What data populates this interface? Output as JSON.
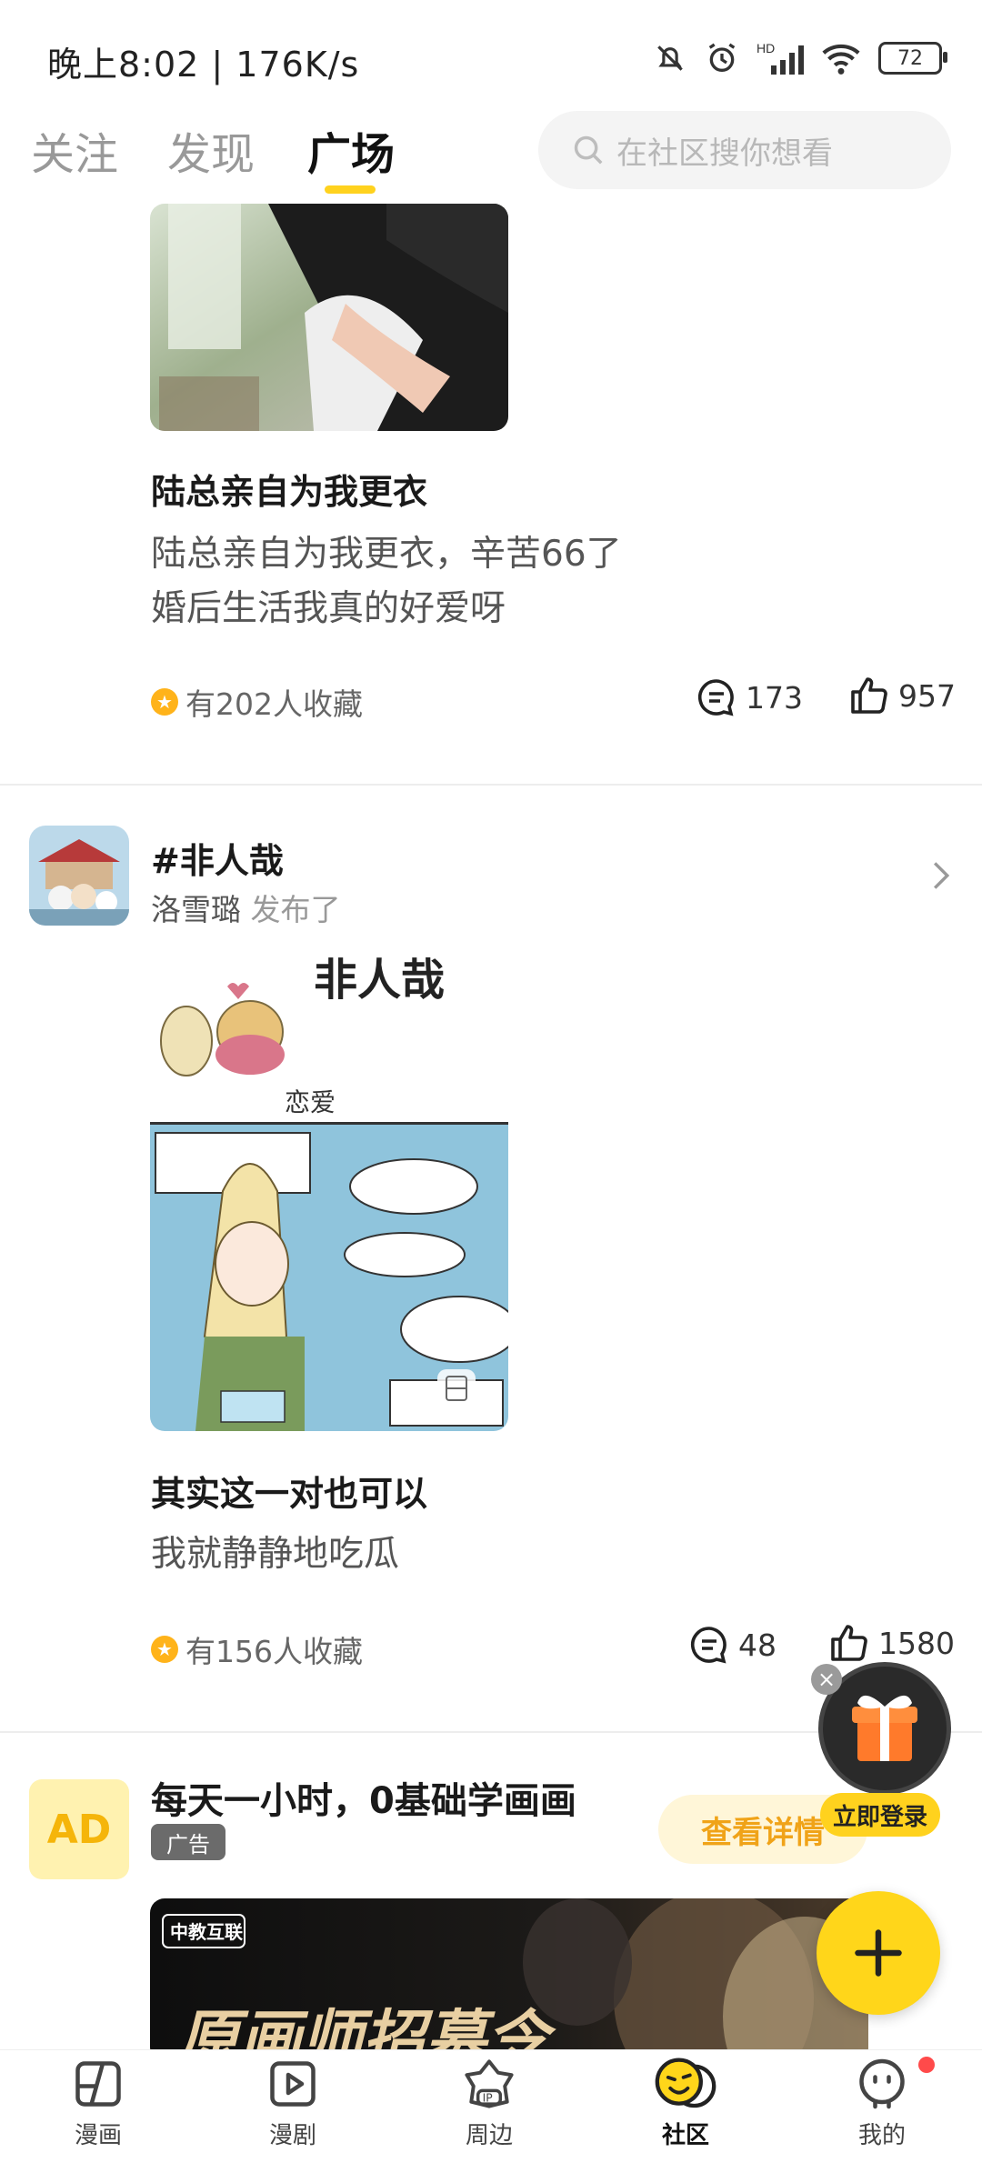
{
  "status_bar": {
    "time": "晚上8:02 | 176K/s",
    "battery": "72"
  },
  "top_tabs": [
    {
      "label": "关注"
    },
    {
      "label": "发现"
    },
    {
      "label": "广场"
    }
  ],
  "search": {
    "placeholder": "在社区搜你想看"
  },
  "post1": {
    "title": "陆总亲自为我更衣",
    "body_line1": "陆总亲自为我更衣，辛苦66了",
    "body_line2": "婚后生活我真的好爱呀",
    "favorites": "有202人收藏",
    "comments": "173",
    "likes": "957"
  },
  "post2": {
    "topic": "#非人哉",
    "author": "洛雪璐",
    "action": "发布了",
    "image_title": "非人哉",
    "image_caption": "恋爱",
    "title": "其实这一对也可以",
    "body": "我就静静地吃瓜",
    "favorites": "有156人收藏",
    "comments": "48",
    "likes": "1580"
  },
  "ad": {
    "badge": "AD",
    "title": "每天一小时，0基础学画画",
    "tag": "广告",
    "cta": "查看详情",
    "banner_brand": "中教互联",
    "banner_text": "原画师招募令"
  },
  "floating": {
    "login_label": "立即登录"
  },
  "bottom_nav": [
    {
      "label": "漫画",
      "icon": "comic-icon"
    },
    {
      "label": "漫剧",
      "icon": "play-icon"
    },
    {
      "label": "周边",
      "icon": "ip-icon"
    },
    {
      "label": "社区",
      "icon": "community-icon"
    },
    {
      "label": "我的",
      "icon": "profile-icon"
    }
  ],
  "colors": {
    "accent": "#ffd21e",
    "star": "#ffb31a",
    "cta_text": "#f0a318",
    "notification_dot": "#ff4a4a"
  }
}
